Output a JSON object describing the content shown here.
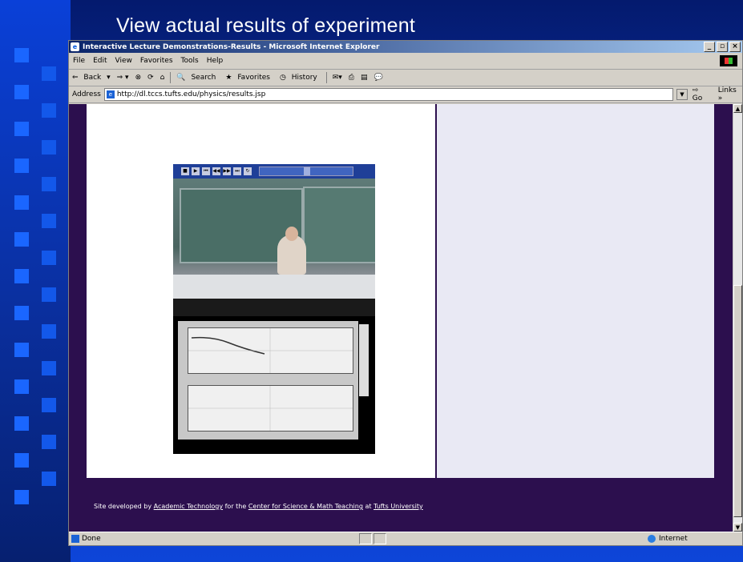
{
  "slide": {
    "title": "View actual results of experiment"
  },
  "browser": {
    "window_title": "Interactive Lecture Demonstrations-Results - Microsoft Internet Explorer",
    "menu": [
      "File",
      "Edit",
      "View",
      "Favorites",
      "Tools",
      "Help"
    ],
    "toolbar": {
      "back": "Back",
      "search": "Search",
      "favorites": "Favorites",
      "history": "History"
    },
    "address": {
      "label": "Address",
      "url": "http://dl.tccs.tufts.edu/physics/results.jsp",
      "go": "Go",
      "links": "Links"
    },
    "status": {
      "text": "Done",
      "zone": "Internet"
    }
  },
  "page": {
    "footer": {
      "prefix": "Site developed by",
      "link1": "Academic Technology",
      "mid": "for the",
      "link2": "Center for Science & Math Teaching",
      "mid2": "at",
      "link3": "Tufts University"
    }
  },
  "colors": {
    "slide_blue": "#0a2e9c",
    "bullet_blue": "#1a66ff",
    "page_purple": "#2c0f4e",
    "right_panel": "#e9e9f4"
  }
}
